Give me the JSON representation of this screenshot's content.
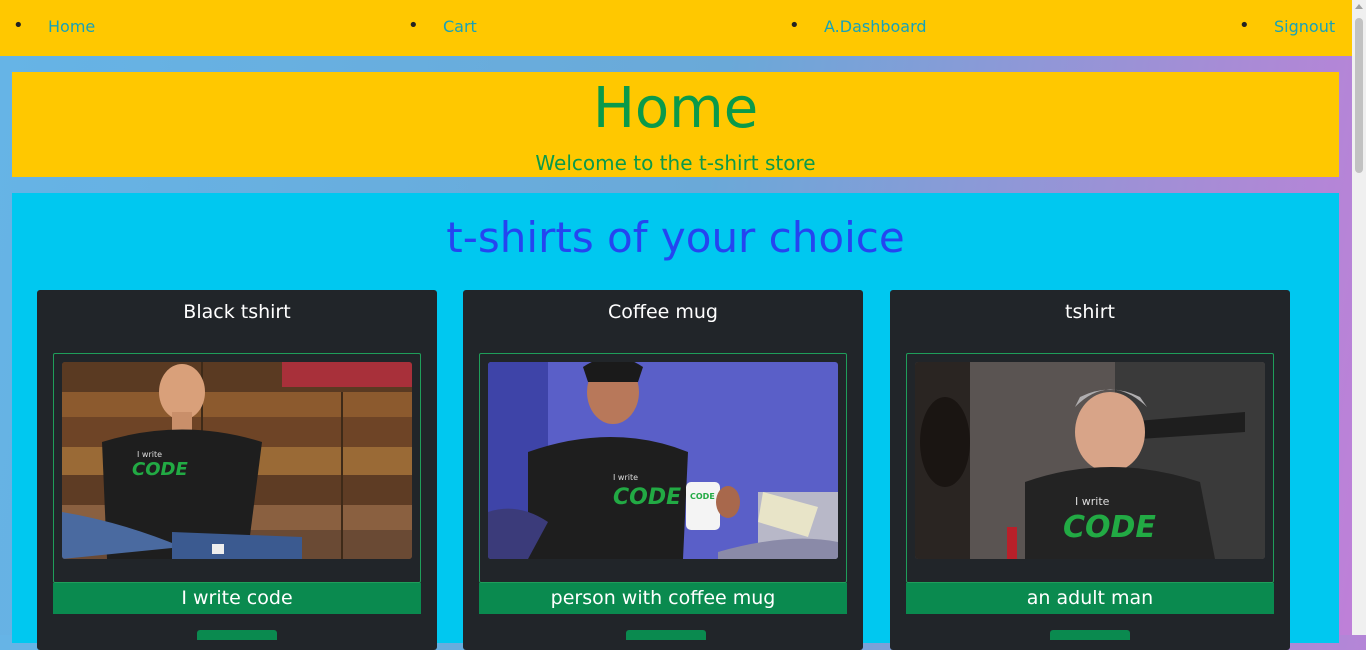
{
  "nav": {
    "items": [
      {
        "label": "Home"
      },
      {
        "label": "Cart"
      },
      {
        "label": "A.Dashboard"
      },
      {
        "label": "Signout"
      }
    ]
  },
  "jumbotron": {
    "title": "Home",
    "subtitle": "Welcome to the t-shirt store"
  },
  "main": {
    "heading": "t-shirts of your choice",
    "cards": [
      {
        "title": "Black tshirt",
        "caption": "I write code"
      },
      {
        "title": "Coffee mug",
        "caption": "person with coffee mug"
      },
      {
        "title": "tshirt",
        "caption": "an adult man"
      }
    ]
  },
  "colors": {
    "nav_bg": "#ffc800",
    "link": "#17a2b8",
    "heading_green": "#0a9a4a",
    "section_bg": "#00c8f0",
    "section_heading": "#2545f0",
    "card_bg": "#212529",
    "caption_bg": "#0a8a4f"
  }
}
